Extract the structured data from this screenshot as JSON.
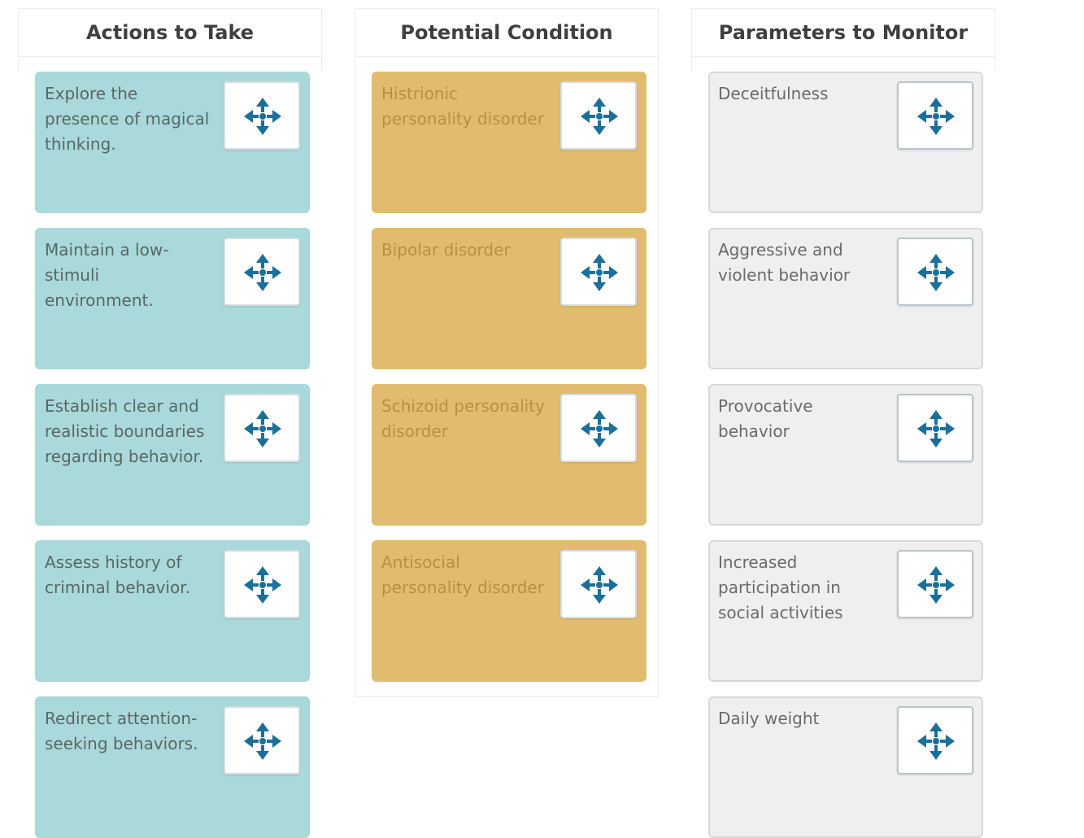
{
  "columns": [
    {
      "title": "Actions to Take",
      "kind": "action",
      "items": [
        "Explore the presence of magical thinking.",
        "Maintain a low-stimuli environment.",
        "Establish clear and realistic boundaries regarding behavior.",
        "Assess history of criminal behavior.",
        "Redirect attention-seeking behaviors."
      ]
    },
    {
      "title": "Potential Condition",
      "kind": "condition",
      "items": [
        "Histrionic personality disorder",
        "Bipolar disorder",
        "Schizoid personality disorder",
        "Antisocial personality disorder"
      ]
    },
    {
      "title": "Parameters to Monitor",
      "kind": "parameter",
      "items": [
        "Deceitfulness",
        "Aggressive and violent behavior",
        "Provocative behavior",
        "Increased participation in social activities",
        "Daily weight"
      ]
    }
  ],
  "icons": {
    "drag_handle": "move-arrows-icon"
  },
  "colors": {
    "action_card": "#a9d9da",
    "condition_card": "#e2bc6e",
    "parameter_card": "#efefef",
    "icon_blue": "#1a6f9b"
  }
}
